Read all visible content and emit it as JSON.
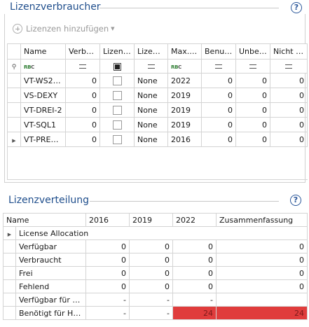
{
  "consumers": {
    "title": "Lizenzverbraucher",
    "add_button_label": "Lizenzen hinzufügen",
    "columns": [
      "Name",
      "Verbra…",
      "Lizenzi…",
      "Lizenz…",
      "Max. …",
      "Benutzt",
      "Unben…",
      "Nicht e…"
    ],
    "rows": [
      {
        "name": "VT-WS2022",
        "verbraucht": "0",
        "lizenz": "None",
        "max": "2022",
        "benutzt": "0",
        "unbenutzt": "0",
        "nicht": "0"
      },
      {
        "name": "VS-DEXY",
        "verbraucht": "0",
        "lizenz": "None",
        "max": "2019",
        "benutzt": "0",
        "unbenutzt": "0",
        "nicht": "0"
      },
      {
        "name": "VT-DREI-2",
        "verbraucht": "0",
        "lizenz": "None",
        "max": "2019",
        "benutzt": "0",
        "unbenutzt": "0",
        "nicht": "0"
      },
      {
        "name": "VT-SQL1",
        "verbraucht": "0",
        "lizenz": "None",
        "max": "2019",
        "benutzt": "0",
        "unbenutzt": "0",
        "nicht": "0"
      },
      {
        "name": "VT-PRER…",
        "verbraucht": "0",
        "lizenz": "None",
        "max": "2016",
        "benutzt": "0",
        "unbenutzt": "0",
        "nicht": "0"
      }
    ]
  },
  "distribution": {
    "title": "Lizenzverteilung",
    "columns": [
      "Name",
      "2016",
      "2019",
      "2022",
      "Zusammenfassung"
    ],
    "group_label": "License Allocation",
    "rows": [
      {
        "label": "Verfügbar",
        "c2016": "0",
        "c2019": "0",
        "c2022": "0",
        "sum": "0"
      },
      {
        "label": "Verbraucht",
        "c2016": "0",
        "c2019": "0",
        "c2022": "0",
        "sum": "0"
      },
      {
        "label": "Frei",
        "c2016": "0",
        "c2019": "0",
        "c2022": "0",
        "sum": "0"
      },
      {
        "label": "Fehlend",
        "c2016": "0",
        "c2019": "0",
        "c2022": "0",
        "sum": "0"
      },
      {
        "label": "Verfügbar für Host",
        "c2016": "-",
        "c2019": "-",
        "c2022": "-",
        "sum": ""
      },
      {
        "label": "Benötigt für Host",
        "c2016": "-",
        "c2019": "-",
        "c2022": "24",
        "sum": "24"
      }
    ],
    "highlight_color": "#e03c3c"
  },
  "help_icon_label": "?"
}
